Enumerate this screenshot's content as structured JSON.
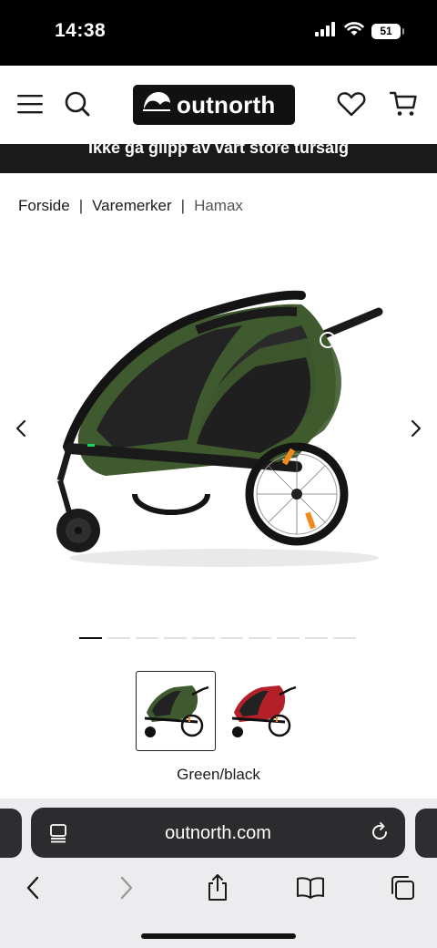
{
  "status_bar": {
    "time": "14:38",
    "battery": "51"
  },
  "header": {
    "logo_text": "outnorth"
  },
  "promo": {
    "text": "Ikke gå glipp av vårt store tursalg"
  },
  "breadcrumb": {
    "items": [
      "Forside",
      "Varemerker",
      "Hamax"
    ],
    "separator": "|"
  },
  "product": {
    "brand_mark": "hamax",
    "image_count": 10,
    "active_image_index": 0
  },
  "variants": {
    "selected_label": "Green/black",
    "colors": [
      "#3f5a2e",
      "#b3202a"
    ]
  },
  "browser": {
    "url": "outnorth.com"
  }
}
